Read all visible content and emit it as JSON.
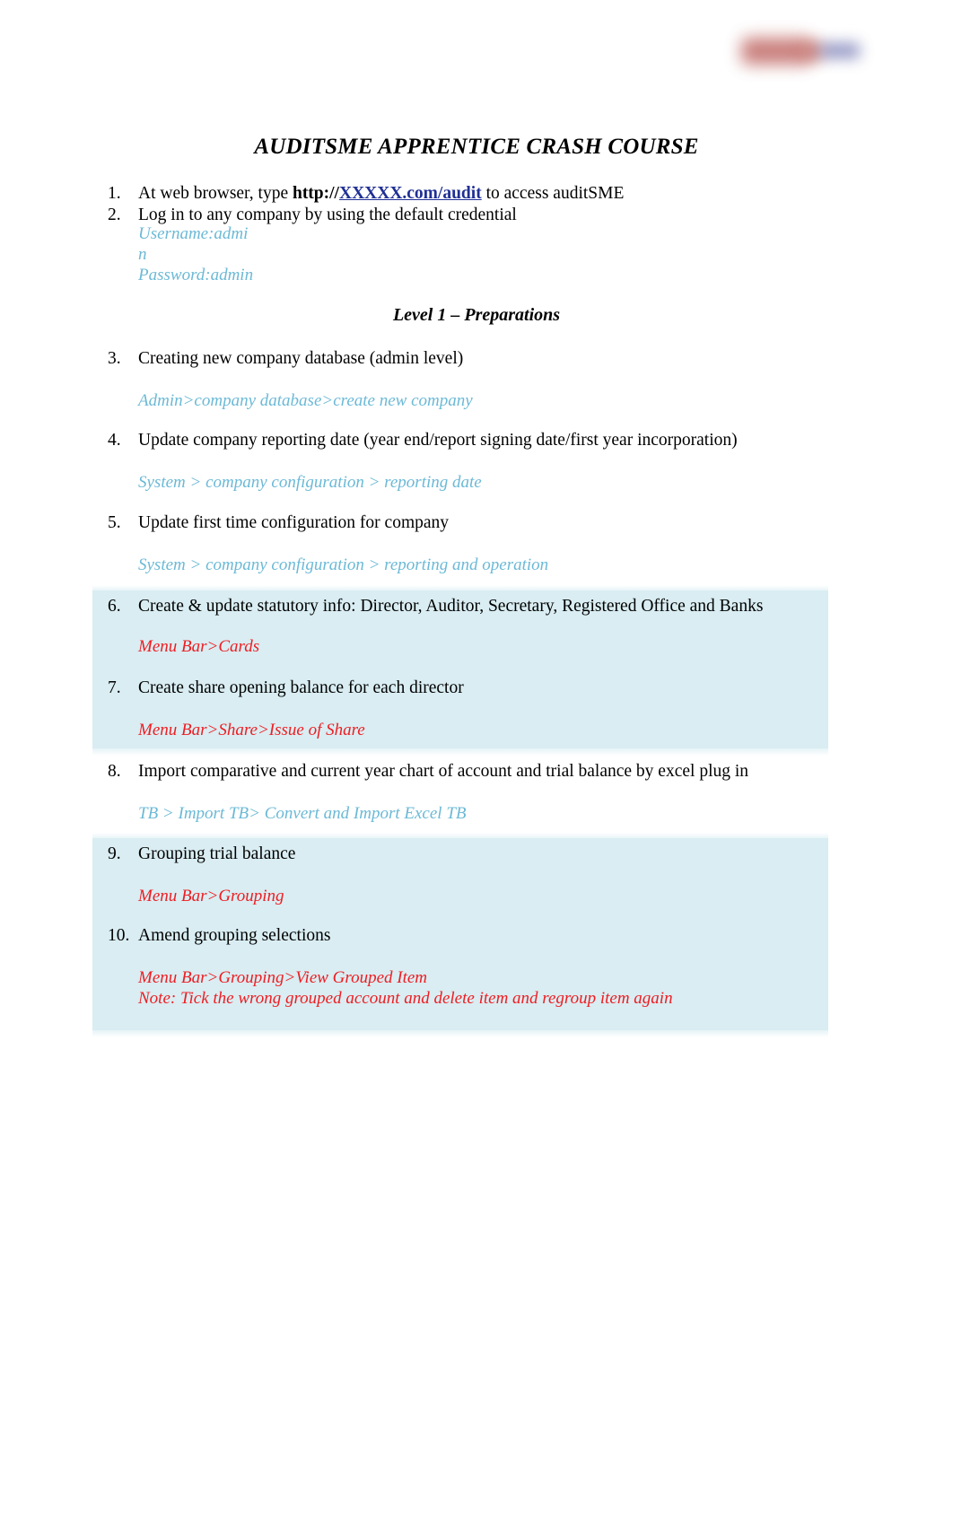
{
  "document": {
    "title": "AUDITSME APPRENTICE CRASH COURSE",
    "section_heading": "Level 1 – Preparations",
    "logo": {
      "name": "company-logo-redacted",
      "primary_color": "#c06a66",
      "secondary_color": "#6f74b0"
    }
  },
  "intro": {
    "item1": {
      "number": "1.",
      "text_before": "At web browser, type ",
      "url_scheme": "http://",
      "url_host": "XXXXX.com/audit",
      "text_after": " to access auditSME"
    },
    "item2": {
      "number": "2.",
      "text": "Log in to any company by using the default credential",
      "username_line": "Username:admi",
      "username_wrap": "n",
      "password_line": "Password:admin"
    }
  },
  "steps": [
    {
      "number": "3.",
      "text": "Creating new company database (admin level)",
      "path": "Admin>company database>create new company",
      "path_color": "teal",
      "highlighted": false
    },
    {
      "number": "4.",
      "text": "Update company reporting date (year end/report signing date/first year incorporation)",
      "path": "System > company configuration > reporting date",
      "path_color": "teal",
      "highlighted": false
    },
    {
      "number": "5.",
      "text": "Update first time configuration for company",
      "path": "System > company configuration > reporting and operation",
      "path_color": "teal",
      "highlighted": false
    },
    {
      "number": "6.",
      "text": "Create & update statutory info: Director, Auditor, Secretary, Registered Office and Banks",
      "path": "Menu Bar>Cards",
      "path_color": "red",
      "highlighted": true
    },
    {
      "number": "7.",
      "text": "Create share opening balance for each director",
      "path": "Menu Bar>Share>Issue of Share",
      "path_color": "red",
      "highlighted": true
    },
    {
      "number": "8.",
      "text": "Import comparative and current year chart of account and trial balance by excel plug in",
      "path": "TB > Import TB> Convert and Import Excel TB",
      "path_color": "teal",
      "highlighted": false
    },
    {
      "number": "9.",
      "text": "Grouping trial balance",
      "path": "Menu Bar>Grouping",
      "path_color": "red",
      "highlighted": true
    },
    {
      "number": "10.",
      "text": "Amend grouping selections",
      "path": "Menu Bar>Grouping>View Grouped Item",
      "note": "Note: Tick the wrong grouped account and delete item and regroup item again",
      "path_color": "red",
      "highlighted": true
    }
  ],
  "colors": {
    "highlight_background": "#d9edf2",
    "teal_path": "#6bb9d6",
    "red_path": "#ee1d22",
    "link": "#1f2f94"
  }
}
